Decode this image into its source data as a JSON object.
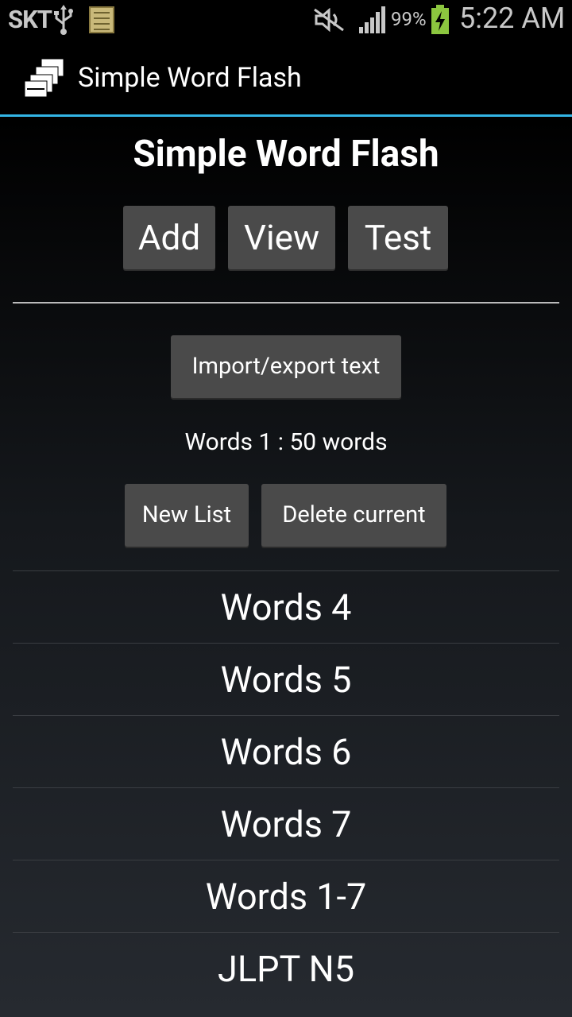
{
  "status_bar": {
    "carrier": "SKT",
    "battery_percent": "99%",
    "time": "5:22 AM",
    "icons": [
      "usb-icon",
      "notes-icon",
      "mute-icon",
      "signal-icon",
      "battery-charging-icon"
    ]
  },
  "action_bar": {
    "title": "Simple Word Flash",
    "accent": "#33b5e5"
  },
  "main": {
    "title": "Simple Word Flash",
    "buttons": {
      "add": "Add",
      "view": "View",
      "test": "Test",
      "import_export": "Import/export text",
      "new_list": "New List",
      "delete_current": "Delete current"
    },
    "current_list_info": "Words 1 : 50 words",
    "lists": [
      {
        "label": "Words 4"
      },
      {
        "label": "Words 5"
      },
      {
        "label": "Words 6"
      },
      {
        "label": "Words 7"
      },
      {
        "label": "Words 1-7"
      },
      {
        "label": "JLPT N5"
      }
    ]
  }
}
